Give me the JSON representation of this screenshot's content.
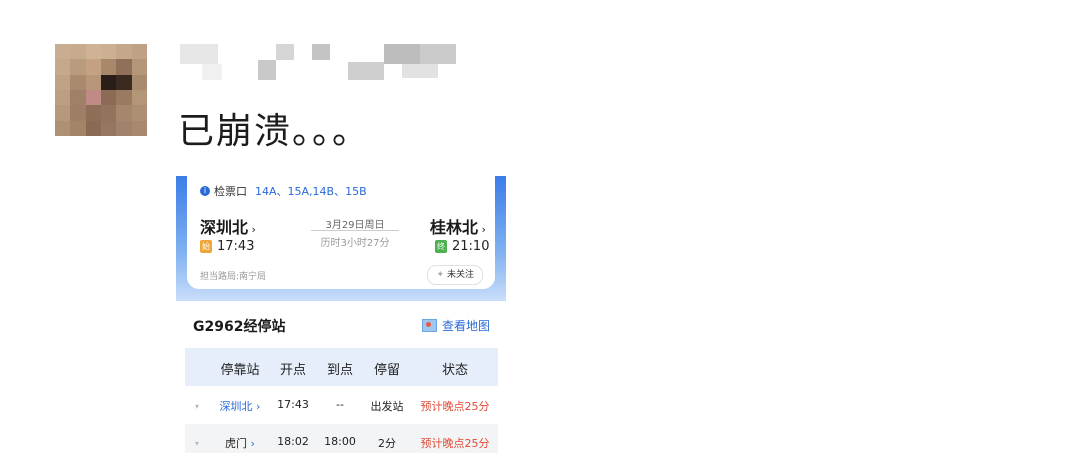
{
  "post": {
    "text": "已崩溃。。。"
  },
  "ticket": {
    "gate_label": "检票口",
    "gates": "14A、15A,14B、15B",
    "from_station": "深圳北",
    "from_tag": "始",
    "depart_time": "17:43",
    "to_station": "桂林北",
    "to_tag": "终",
    "arrive_time": "21:10",
    "date": "3月29日周日",
    "duration": "历时3小时27分",
    "bureau": "担当路局:南宁局",
    "follow": "未关注"
  },
  "stops": {
    "title": "G2962经停站",
    "map_link": "查看地图",
    "headers": [
      "停靠站",
      "开点",
      "到点",
      "停留",
      "状态"
    ],
    "rows": [
      {
        "station": "深圳北",
        "depart": "17:43",
        "arrive": "--",
        "stay": "出发站",
        "status": "预计晚点25分"
      },
      {
        "station": "虎门",
        "depart": "18:02",
        "arrive": "18:00",
        "stay": "2分",
        "status": "预计晚点25分"
      }
    ]
  },
  "colors": {
    "accent": "#2a6ad8",
    "late": "#e14a35",
    "header_bg": "#e6eefb"
  }
}
